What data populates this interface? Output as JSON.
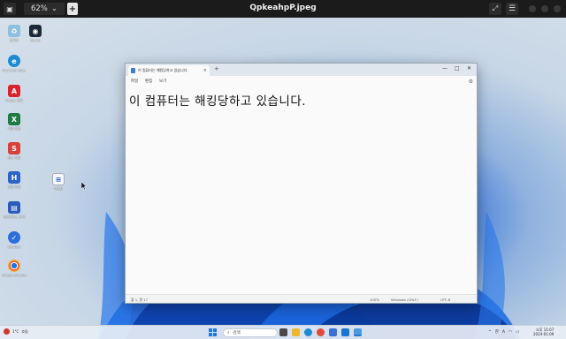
{
  "viewer": {
    "zoom": "62%",
    "title": "QpkeahpP.jpeg",
    "left_icon": "sidebar-toggle-icon",
    "plus_label": "+",
    "fullscreen_icon": "fullscreen-icon",
    "menu_icon": "hamburger-menu-icon"
  },
  "desktop": {
    "icons": [
      {
        "label": "휴지통",
        "color": "#8fbfe0",
        "glyph": "♻",
        "name": "recycle-bin-icon"
      },
      {
        "label": "Steam",
        "color": "#1b2838",
        "glyph": "◉",
        "name": "steam-icon"
      },
      {
        "label": "Microsoft Edge",
        "color": "#1f8ad1",
        "glyph": "e",
        "name": "edge-icon"
      },
      {
        "label": "Adobe 파일",
        "color": "#d9232e",
        "glyph": "A",
        "name": "pdf-app-icon"
      },
      {
        "label": "엑셀 파일",
        "color": "#1f7a44",
        "glyph": "X",
        "name": "excel-icon"
      },
      {
        "label": "한쇼 파일",
        "color": "#d8403a",
        "glyph": "S",
        "name": "hanshow-icon"
      },
      {
        "label": "한글 파일",
        "color": "#2d62c7",
        "glyph": "H",
        "name": "hwp-icon"
      },
      {
        "label": "메모장",
        "color": "#ffffff",
        "glyph": "≡",
        "name": "notepad-file-icon"
      },
      {
        "label": "한컴오피스 문서",
        "color": "#2a5bb8",
        "glyph": "▤",
        "name": "hancom-icon"
      },
      {
        "label": "StatDist",
        "color": "#2d6fd8",
        "glyph": "✓",
        "name": "statdist-icon"
      },
      {
        "label": "Google Chrome",
        "color": "#ffffff",
        "glyph": "◎",
        "name": "chrome-icon"
      }
    ]
  },
  "notepad": {
    "tab_title": "이 컴퓨터는 해킹당하고 있습니다.",
    "tab_close": "×",
    "new_tab": "+",
    "controls": {
      "min": "—",
      "max": "□",
      "close": "✕"
    },
    "menu": [
      "파일",
      "편집",
      "보기"
    ],
    "content": "이 컴퓨터는 해킹당하고 있습니다.",
    "status": {
      "position": "줄 1, 열 17",
      "zoom": "100%",
      "line_ending": "Windows (CRLF)",
      "encoding": "UTF-8"
    }
  },
  "taskbar": {
    "weather_temp": "1°C",
    "weather_desc": "흐림",
    "search_placeholder": "검색",
    "apps": [
      {
        "name": "taskview-icon",
        "color": "#555"
      },
      {
        "name": "file-explorer-icon",
        "color": "#f1b72c"
      },
      {
        "name": "edge-taskbar-icon",
        "color": "#1f8ad1"
      },
      {
        "name": "chrome-taskbar-icon",
        "color": "#e04a3a"
      },
      {
        "name": "store-taskbar-icon",
        "color": "#3a6fd6"
      },
      {
        "name": "mail-taskbar-icon",
        "color": "#1976d2"
      },
      {
        "name": "notepad-taskbar-icon",
        "color": "#4c9be0"
      },
      {
        "name": "photos-taskbar-icon",
        "color": "#2aa2e6"
      }
    ],
    "tray": [
      "^",
      "한",
      "A"
    ],
    "time": "오후 11:07",
    "date": "2024-01-09"
  },
  "colors": {
    "accent": "#1e78d7",
    "bloom": "#1656d0"
  }
}
